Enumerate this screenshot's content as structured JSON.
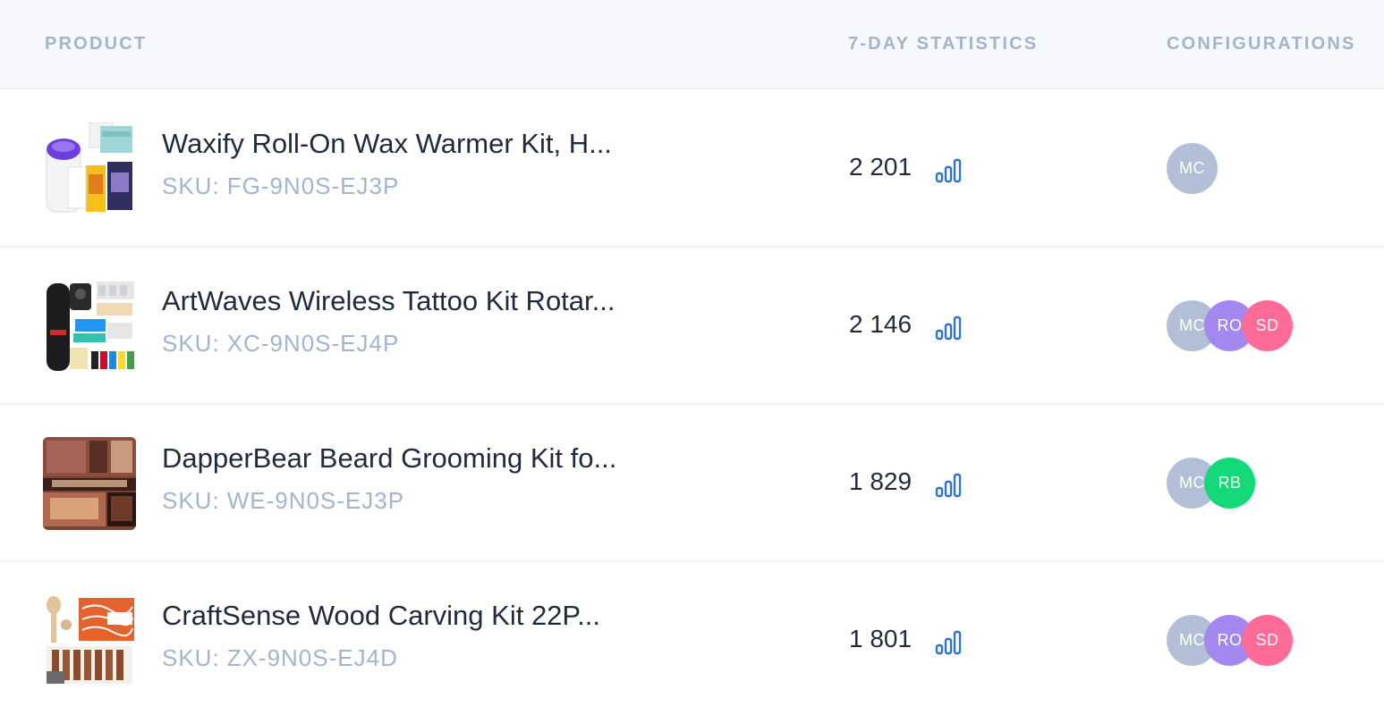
{
  "header": {
    "product": "PRODUCT",
    "statistics": "7-DAY STATISTICS",
    "configurations": "CONFIGURATIONS"
  },
  "colors": {
    "header_bg": "#f6f8fb",
    "header_text": "#a3b5cc",
    "primary_text": "#1f2a3c",
    "muted_text": "#a3b5cc",
    "stat_icon": "#2f74d0",
    "avatar_mc": "#b1c0d6",
    "avatar_ro": "#a487f0",
    "avatar_sd": "#ff6b98",
    "avatar_rb": "#14d979"
  },
  "sku_prefix": "SKU:",
  "rows": [
    {
      "name": "Waxify Roll-On Wax Warmer Kit, H...",
      "sku": "FG-9N0S-EJ3P",
      "count": "2 201",
      "stat_icon": "bar-chart-icon",
      "avatars": [
        {
          "initials": "MC",
          "color": "#b1c0d6"
        }
      ]
    },
    {
      "name": "ArtWaves Wireless Tattoo Kit Rotar...",
      "sku": "XC-9N0S-EJ4P",
      "count": "2 146",
      "stat_icon": "bar-chart-icon",
      "avatars": [
        {
          "initials": "MC",
          "color": "#b1c0d6"
        },
        {
          "initials": "RO",
          "color": "#a487f0"
        },
        {
          "initials": "SD",
          "color": "#ff6b98"
        }
      ]
    },
    {
      "name": "DapperBear Beard Grooming Kit fo...",
      "sku": "WE-9N0S-EJ3P",
      "count": "1 829",
      "stat_icon": "bar-chart-icon",
      "avatars": [
        {
          "initials": "MC",
          "color": "#b1c0d6"
        },
        {
          "initials": "RB",
          "color": "#14d979"
        }
      ]
    },
    {
      "name": "CraftSense Wood Carving Kit 22P...",
      "sku": "ZX-9N0S-EJ4D",
      "count": "1 801",
      "stat_icon": "bar-chart-icon",
      "avatars": [
        {
          "initials": "MC",
          "color": "#b1c0d6"
        },
        {
          "initials": "RO",
          "color": "#a487f0"
        },
        {
          "initials": "SD",
          "color": "#ff6b98"
        }
      ]
    }
  ]
}
